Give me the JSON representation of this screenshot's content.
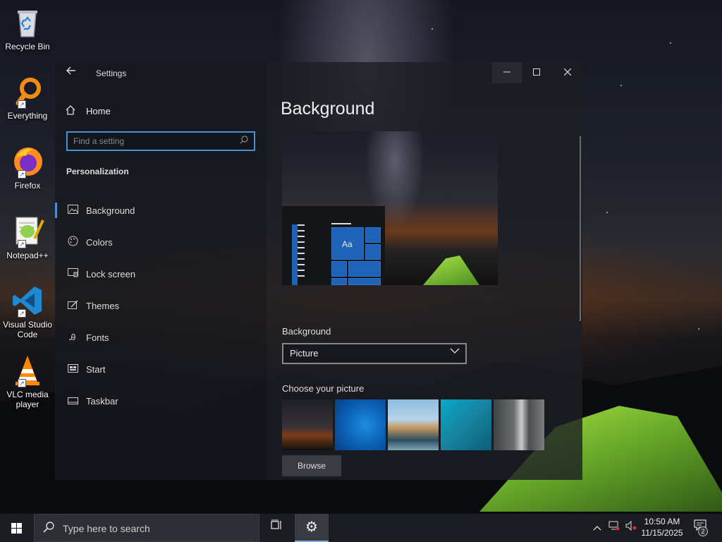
{
  "desktop": {
    "icons": [
      {
        "label": "Recycle Bin",
        "icon": "recycle-bin-icon"
      },
      {
        "label": "Everything",
        "icon": "everything-search-icon"
      },
      {
        "label": "Firefox",
        "icon": "firefox-icon"
      },
      {
        "label": "Notepad++",
        "icon": "notepad-plus-plus-icon"
      },
      {
        "label": "Visual Studio Code",
        "icon": "vscode-icon"
      },
      {
        "label": "VLC media player",
        "icon": "vlc-icon"
      }
    ]
  },
  "settings": {
    "window_title": "Settings",
    "home_label": "Home",
    "search_placeholder": "Find a setting",
    "section_title": "Personalization",
    "nav_items": [
      {
        "label": "Background",
        "icon": "picture-icon",
        "selected": true
      },
      {
        "label": "Colors",
        "icon": "palette-icon",
        "selected": false
      },
      {
        "label": "Lock screen",
        "icon": "lock-screen-icon",
        "selected": false
      },
      {
        "label": "Themes",
        "icon": "themes-icon",
        "selected": false
      },
      {
        "label": "Fonts",
        "icon": "fonts-icon",
        "selected": false
      },
      {
        "label": "Start",
        "icon": "start-icon",
        "selected": false
      },
      {
        "label": "Taskbar",
        "icon": "taskbar-icon",
        "selected": false
      }
    ],
    "page_title": "Background",
    "preview_tile_text": "Aa",
    "background_label": "Background",
    "background_value": "Picture",
    "choose_picture_label": "Choose your picture",
    "browse_label": "Browse",
    "accent_color": "#1e63b8"
  },
  "taskbar": {
    "search_placeholder": "Type here to search",
    "clock_time": "10:50 AM",
    "clock_date": "11/15/2025",
    "notification_count": "2"
  }
}
